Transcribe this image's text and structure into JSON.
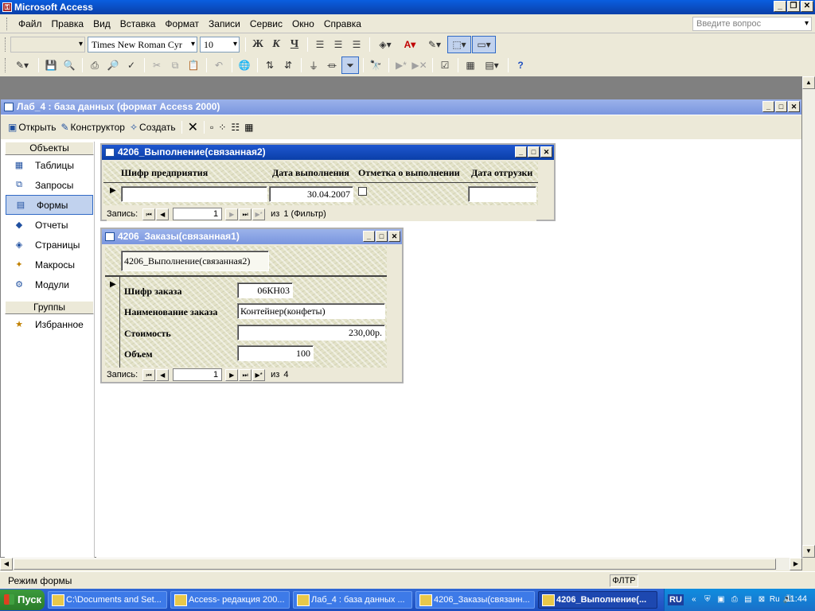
{
  "app": {
    "title": "Microsoft Access"
  },
  "menu": {
    "items": [
      "Файл",
      "Правка",
      "Вид",
      "Вставка",
      "Формат",
      "Записи",
      "Сервис",
      "Окно",
      "Справка"
    ],
    "ask_placeholder": "Введите вопрос"
  },
  "formatting_toolbar": {
    "object_combo": "",
    "font": "Times New Roman Cyr",
    "size": "10",
    "bold": "Ж",
    "italic": "К",
    "underline": "Ч"
  },
  "db_window": {
    "title": "Лаб_4 : база данных (формат Access 2000)",
    "tools": {
      "open": "Открыть",
      "design": "Конструктор",
      "create": "Создать"
    },
    "objects_header": "Объекты",
    "objects": [
      {
        "label": "Таблицы",
        "icon": "table-icon"
      },
      {
        "label": "Запросы",
        "icon": "query-icon"
      },
      {
        "label": "Формы",
        "icon": "form-icon"
      },
      {
        "label": "Отчеты",
        "icon": "report-icon"
      },
      {
        "label": "Страницы",
        "icon": "page-icon"
      },
      {
        "label": "Макросы",
        "icon": "macro-icon"
      },
      {
        "label": "Модули",
        "icon": "module-icon"
      }
    ],
    "groups_header": "Группы",
    "groups": [
      {
        "label": "Избранное",
        "icon": "favorites-icon"
      }
    ]
  },
  "form_execution": {
    "title": "4206_Выполнение(связанная2)",
    "columns": [
      "Шифр предприятия",
      "Дата выполнения",
      "Отметка о выполнении",
      "Дата отгрузки"
    ],
    "row": {
      "company_code": "",
      "exec_date": "30.04.2007",
      "done": false,
      "ship_date": ""
    },
    "nav": {
      "label": "Запись:",
      "current": "1",
      "of": "из",
      "total": "1 (Фильтр)"
    }
  },
  "form_orders": {
    "title": "4206_Заказы(связанная1)",
    "tab_label": "4206_Выполнение(связанная2)",
    "fields": [
      {
        "label": "Шифр заказа",
        "value": "06КН03"
      },
      {
        "label": "Наименование заказа",
        "value": "Контейнер(конфеты)"
      },
      {
        "label": "Стоимость",
        "value": "230,00р."
      },
      {
        "label": "Объем",
        "value": "100"
      }
    ],
    "nav": {
      "label": "Запись:",
      "current": "1",
      "of": "из",
      "total": "4"
    }
  },
  "status": {
    "mode": "Режим формы",
    "filter": "ФЛТР"
  },
  "taskbar": {
    "start": "Пуск",
    "tasks": [
      {
        "label": "C:\\Documents and Set..."
      },
      {
        "label": "Access- редакция 200..."
      },
      {
        "label": "Лаб_4 : база данных ..."
      },
      {
        "label": "4206_Заказы(связанн..."
      },
      {
        "label": "4206_Выполнение(..."
      }
    ],
    "lang": "RU",
    "chevron": "«",
    "tray_lang": "Ru",
    "clock": "11:44"
  }
}
